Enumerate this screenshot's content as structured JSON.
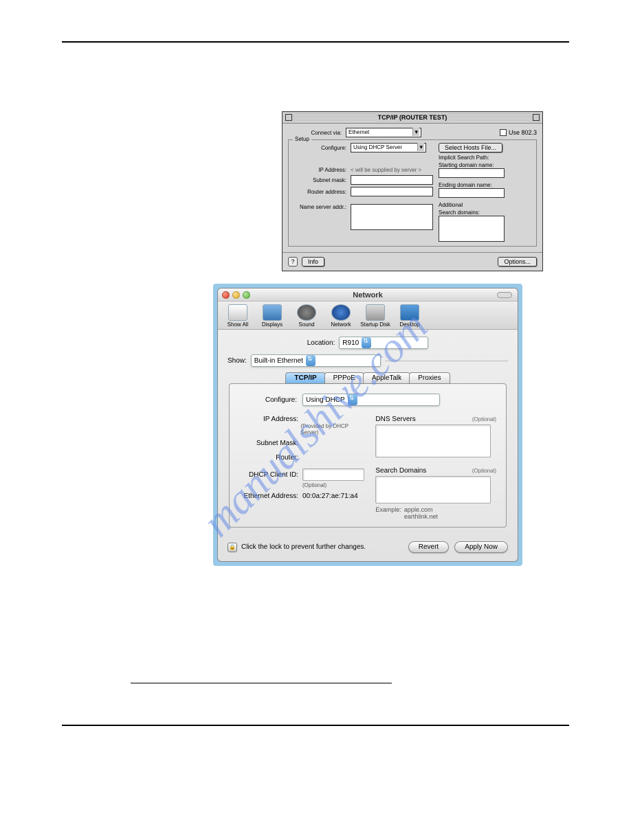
{
  "watermark": "manualshive.com",
  "os9": {
    "title": "TCP/IP (ROUTER TEST)",
    "connect_via_label": "Connect via:",
    "connect_via_value": "Ethernet",
    "use_8023_label": "Use 802.3",
    "setup_legend": "Setup",
    "configure_label": "Configure:",
    "configure_value": "Using DHCP Server",
    "select_hosts_btn": "Select Hosts File...",
    "implicit_label": "Implicit Search Path:",
    "starting_label": "Starting domain name:",
    "ip_label": "IP Address:",
    "ip_placeholder": "< will be supplied by server >",
    "subnet_label": "Subnet mask:",
    "ending_label": "Ending domain name:",
    "router_label": "Router address:",
    "additional_label": "Additional",
    "search_domains_label": "Search domains:",
    "ns_label": "Name server addr.:",
    "info_btn": "Info",
    "options_btn": "Options...",
    "help_glyph": "?"
  },
  "osx": {
    "window_title": "Network",
    "toolbar": [
      "Show All",
      "Displays",
      "Sound",
      "Network",
      "Startup Disk",
      "Desktop"
    ],
    "location_label": "Location:",
    "location_value": "R910",
    "show_label": "Show:",
    "show_value": "Built-in Ethernet",
    "tabs": [
      "TCP/IP",
      "PPPoE",
      "AppleTalk",
      "Proxies"
    ],
    "configure_label": "Configure:",
    "configure_value": "Using DHCP",
    "ip_label": "IP Address:",
    "ip_sub": "(Provided by DHCP Server)",
    "subnet_label": "Subnet Mask:",
    "router_label": "Router:",
    "dhcp_client_label": "DHCP Client ID:",
    "dhcp_client_sub": "(Optional)",
    "eth_label": "Ethernet Address:",
    "eth_value": "00:0a:27:ae:71:a4",
    "dns_label": "DNS Servers",
    "optional": "(Optional)",
    "search_label": "Search Domains",
    "example_label": "Example:",
    "example1": "apple.com",
    "example2": "earthlink.net",
    "lock_text": "Click the lock to prevent further changes.",
    "revert_btn": "Revert",
    "apply_btn": "Apply Now"
  }
}
